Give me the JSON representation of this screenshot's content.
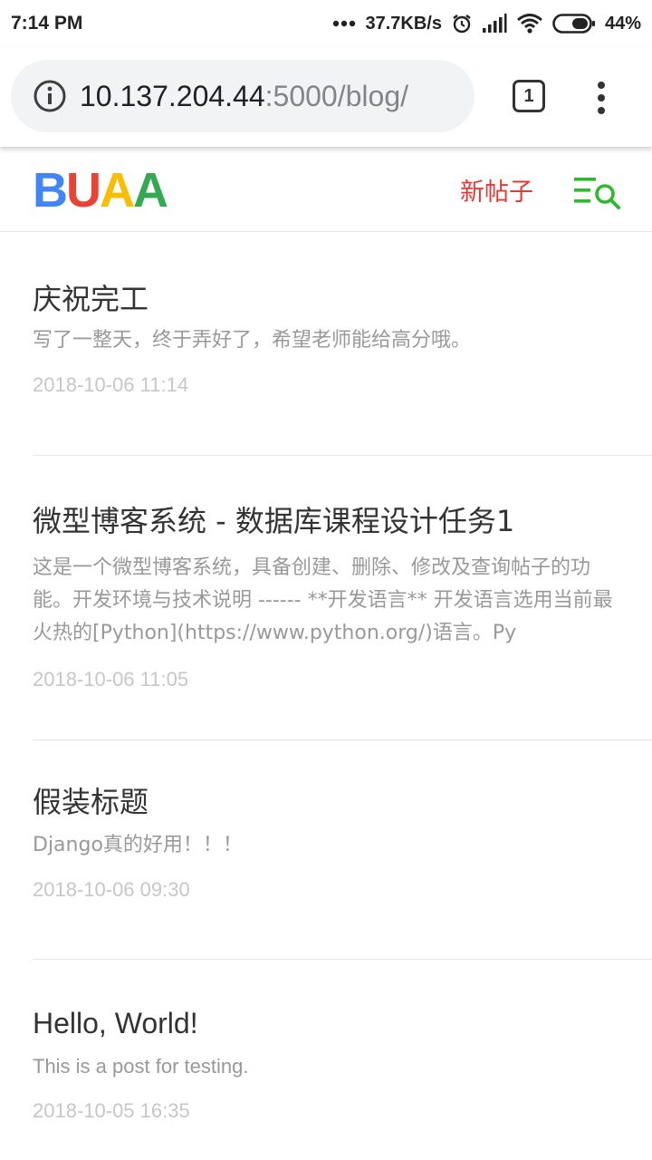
{
  "status_bar": {
    "time": "7:14 PM",
    "network_speed": "37.7KB/s",
    "battery": "44%",
    "icons": [
      "dots-icon",
      "alarm-icon",
      "signal-icon",
      "wifi-icon",
      "battery-icon"
    ]
  },
  "browser": {
    "url_host": "10.137.204.44",
    "url_rest": ":5000/blog/",
    "tab_count": "1",
    "icons": [
      "info-icon",
      "tabs-icon",
      "overflow-menu-icon"
    ]
  },
  "site_header": {
    "logo": [
      "B",
      "U",
      "A",
      "A"
    ],
    "logo_colors": [
      "#4285f4",
      "#ea4335",
      "#fbbc05",
      "#34a853"
    ],
    "new_post_label": "新帖子",
    "accent_red": "#e53935",
    "accent_green": "#2db82d"
  },
  "posts": [
    {
      "title": "庆祝完工",
      "excerpt": "写了一整天，终于弄好了，希望老师能给高分哦。",
      "date": "2018-10-06 11:14"
    },
    {
      "title": "微型博客系统 - 数据库课程设计任务1",
      "excerpt": "这是一个微型博客系统，具备创建、删除、修改及查询帖子的功能。开发环境与技术说明 ------ **开发语言** 开发语言选用当前最火热的[Python](https://www.python.org/)语言。Py",
      "date": "2018-10-06 11:05"
    },
    {
      "title": "假装标题",
      "excerpt": "Django真的好用！！！",
      "date": "2018-10-06 09:30"
    },
    {
      "title": "Hello, World!",
      "excerpt": "This is a post for testing.",
      "date": "2018-10-05 16:35"
    }
  ]
}
